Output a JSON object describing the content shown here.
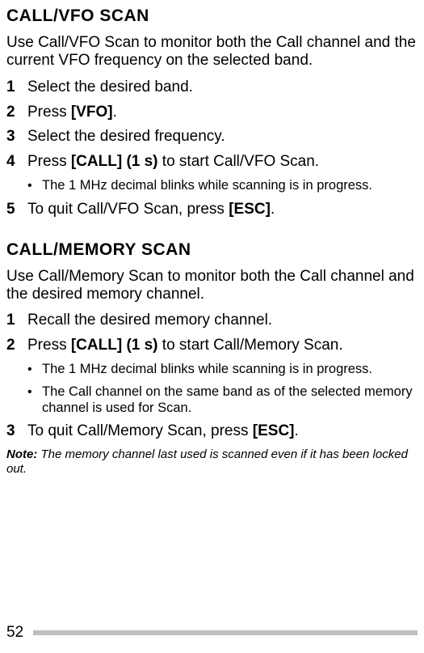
{
  "section1": {
    "title": "CALL/VFO SCAN",
    "intro": "Use Call/VFO Scan to monitor both the Call channel and the current VFO frequency on the selected band.",
    "steps": [
      {
        "num": "1",
        "text": "Select the desired band."
      },
      {
        "num": "2",
        "text_pre": "Press ",
        "key": "[VFO]",
        "text_post": "."
      },
      {
        "num": "3",
        "text": "Select the desired frequency."
      },
      {
        "num": "4",
        "text_pre": "Press ",
        "key": "[CALL] (1 s)",
        "text_post": " to start Call/VFO Scan.",
        "bullets": [
          "The 1 MHz decimal blinks while scanning is in progress."
        ]
      },
      {
        "num": "5",
        "text_pre": "To quit Call/VFO Scan, press ",
        "key": "[ESC]",
        "text_post": "."
      }
    ]
  },
  "section2": {
    "title": "CALL/MEMORY SCAN",
    "intro": "Use Call/Memory Scan to monitor both the Call channel and the desired memory channel.",
    "steps": [
      {
        "num": "1",
        "text": "Recall the desired memory channel."
      },
      {
        "num": "2",
        "text_pre": "Press ",
        "key": "[CALL] (1 s)",
        "text_post": " to start Call/Memory Scan.",
        "bullets": [
          "The 1 MHz decimal blinks while scanning is in progress.",
          "The Call channel on the same band as of the selected memory channel is used for Scan."
        ]
      },
      {
        "num": "3",
        "text_pre": "To quit Call/Memory Scan, press ",
        "key": "[ESC]",
        "text_post": "."
      }
    ],
    "note_label": "Note:",
    "note_body": "  The memory channel last used is scanned even if it has been locked out."
  },
  "page_number": "52"
}
